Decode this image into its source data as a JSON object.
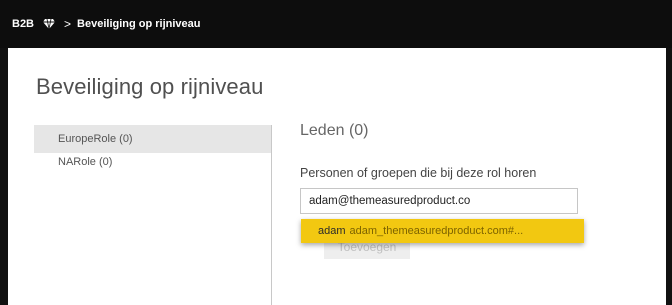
{
  "topbar": {
    "workspace": "B2B",
    "breadcrumb": "Beveiliging op rijniveau"
  },
  "dialog": {
    "title": "Beveiliging op rijniveau"
  },
  "roles": [
    {
      "label": "EuropeRole (0)",
      "selected": true
    },
    {
      "label": "NARole (0)",
      "selected": false
    }
  ],
  "members": {
    "title": "Leden (0)",
    "help_label": "Personen of groepen die bij deze rol horen",
    "search_value": "adam@themeasuredproduct.co",
    "suggestion": {
      "name": "adam",
      "email": "adam_themeasuredproduct.com#..."
    },
    "add_button": "Toevoegen"
  },
  "colors": {
    "topbar": "#0d0d0d",
    "accent": "#f2c811",
    "selected_role": "#e6e6e6"
  },
  "icons": {
    "workspace": "diamond-icon",
    "separator": "chevron-right-icon"
  }
}
